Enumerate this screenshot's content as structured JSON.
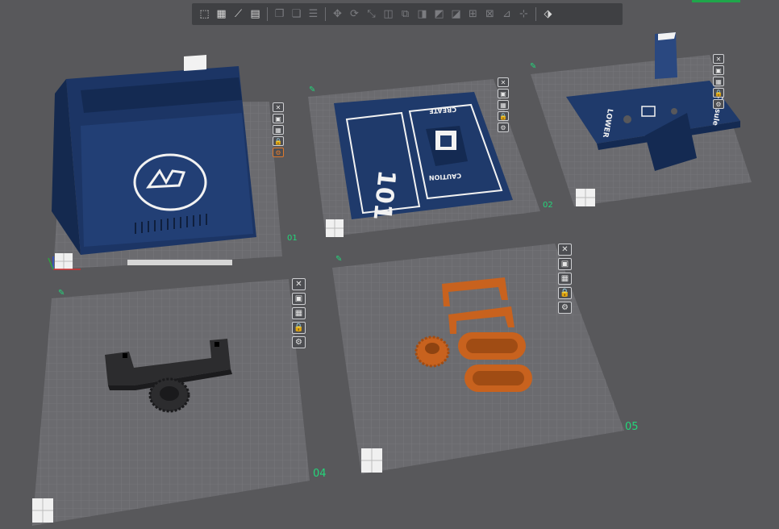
{
  "toolbar": {
    "buttons": [
      {
        "name": "add-plate-icon",
        "glyph": "⬚",
        "enabled": true
      },
      {
        "name": "arrange-icon",
        "glyph": "▦",
        "enabled": true
      },
      {
        "name": "orient-icon",
        "glyph": "⟋",
        "enabled": true
      },
      {
        "name": "layout-icon",
        "glyph": "▤",
        "enabled": true
      },
      {
        "name": "sep"
      },
      {
        "name": "copy-icon",
        "glyph": "❐",
        "enabled": false
      },
      {
        "name": "paste-icon",
        "glyph": "❏",
        "enabled": false
      },
      {
        "name": "list-icon",
        "glyph": "☰",
        "enabled": false
      },
      {
        "name": "sep"
      },
      {
        "name": "move-icon",
        "glyph": "✥",
        "enabled": false
      },
      {
        "name": "rotate-icon",
        "glyph": "⟳",
        "enabled": false
      },
      {
        "name": "scale-icon",
        "glyph": "⤡",
        "enabled": false
      },
      {
        "name": "lay-on-face-icon",
        "glyph": "◫",
        "enabled": false
      },
      {
        "name": "cut-icon",
        "glyph": "⧉",
        "enabled": false
      },
      {
        "name": "mesh-boolean-icon",
        "glyph": "◨",
        "enabled": false
      },
      {
        "name": "support-paint-icon",
        "glyph": "◩",
        "enabled": false
      },
      {
        "name": "seam-paint-icon",
        "glyph": "◪",
        "enabled": false
      },
      {
        "name": "color-paint-icon",
        "glyph": "⊞",
        "enabled": false
      },
      {
        "name": "text-emboss-icon",
        "glyph": "⊠",
        "enabled": false
      },
      {
        "name": "measure-icon",
        "glyph": "⊿",
        "enabled": false
      },
      {
        "name": "assembly-icon",
        "glyph": "⊹",
        "enabled": false
      },
      {
        "name": "sep"
      },
      {
        "name": "view-cube-icon",
        "glyph": "⬗",
        "enabled": true
      }
    ]
  },
  "plates": [
    {
      "id": "01",
      "label": "01"
    },
    {
      "id": "02",
      "label": "02"
    },
    {
      "id": "03",
      "label": ""
    },
    {
      "id": "04",
      "label": "04"
    },
    {
      "id": "05",
      "label": "05"
    }
  ],
  "plate_tool_glyphs": {
    "close": "✕",
    "thumbnail": "▣",
    "arrange": "▦",
    "lock": "🔒",
    "settings": "⚙"
  },
  "model_text": {
    "nav_left": "LOWER",
    "nav_right": "Capsule",
    "panel_top": "CREATE",
    "panel_bottom": "CAUTION",
    "panel_big": "101"
  },
  "colors": {
    "background": "#58585b",
    "plate_surface": "#6c6c70",
    "grid_line": "#7c7c80",
    "navy": "#1f3a6b",
    "navy_dark": "#142a52",
    "white_mark": "#f2f2f2",
    "black_part": "#2c2c2e",
    "orange_part": "#c8621e",
    "green_label": "#23d67a"
  }
}
